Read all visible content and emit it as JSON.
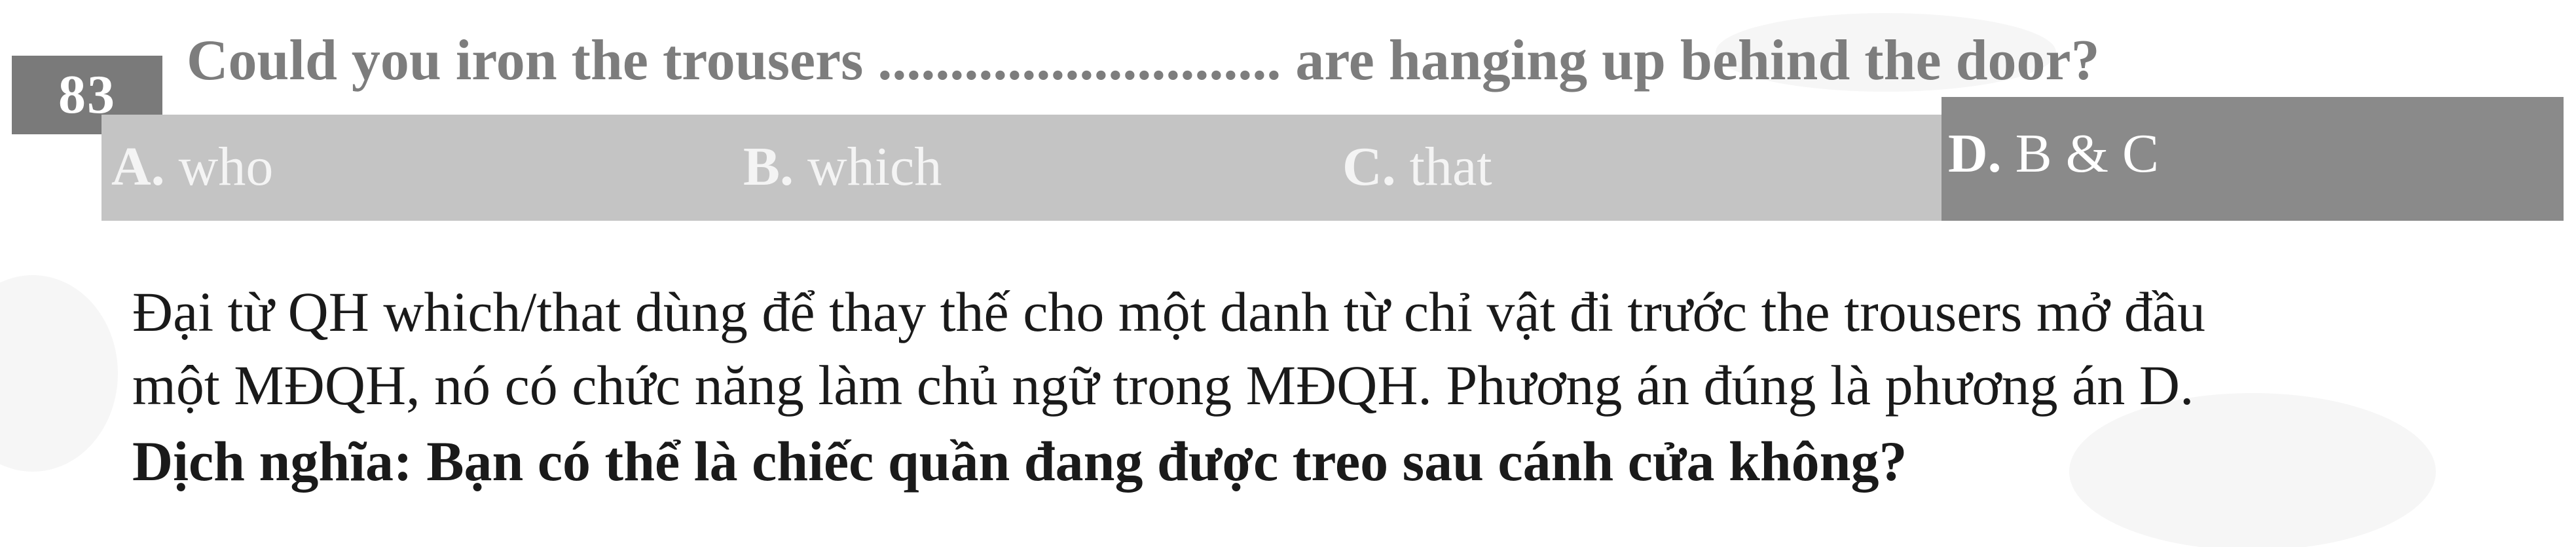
{
  "question": {
    "number": "83",
    "text": "Could you iron the trousers ............................ are hanging up behind the door?"
  },
  "options": [
    {
      "letter": "A.",
      "text": "who"
    },
    {
      "letter": "B.",
      "text": "which"
    },
    {
      "letter": "C.",
      "text": "that"
    },
    {
      "letter": "D.",
      "text": "B & C"
    }
  ],
  "explanation": {
    "line1": "Đại từ QH which/that dùng để thay thế cho một danh từ chỉ vật đi trước the trousers mở đầu",
    "line2": "một MĐQH, nó có chức năng làm chủ ngữ trong MĐQH. Phương án đúng là phương án D."
  },
  "translation": "Dịch nghĩa: Bạn có thể là chiếc quần đang được treo sau cánh cửa không?"
}
